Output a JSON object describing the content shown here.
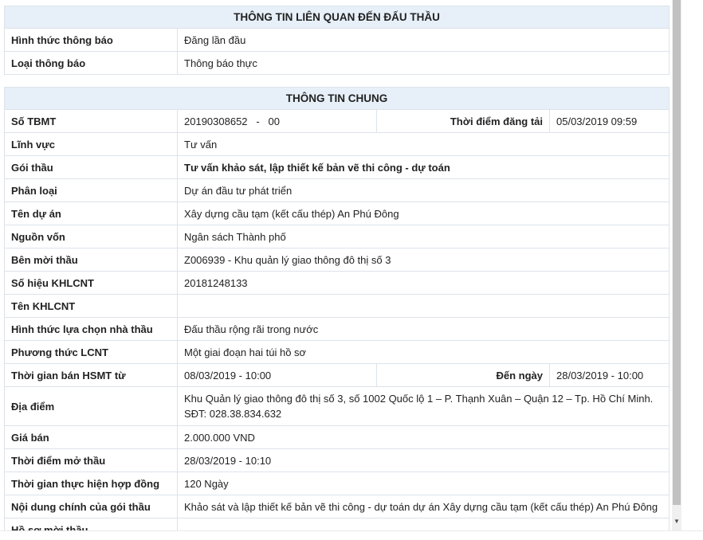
{
  "section1": {
    "title": "THÔNG TIN LIÊN QUAN ĐẾN ĐẤU THẦU",
    "rows": [
      {
        "label": "Hình thức thông báo",
        "value": "Đăng lần đầu"
      },
      {
        "label": "Loại thông báo",
        "value": "Thông báo thực"
      }
    ]
  },
  "section2": {
    "title": "THÔNG TIN CHUNG",
    "so_tbmt": {
      "label": "Số TBMT",
      "value": "20190308652   -   00",
      "sublabel": "Thời điểm đăng tải",
      "subvalue": "05/03/2019 09:59"
    },
    "linh_vuc": {
      "label": "Lĩnh vực",
      "value": "Tư vấn"
    },
    "goi_thau": {
      "label": "Gói thầu",
      "value": "Tư vấn khảo sát, lập thiết kế bản vẽ thi công - dự toán"
    },
    "phan_loai": {
      "label": "Phân loại",
      "value": "Dự án đầu tư phát triển"
    },
    "ten_du_an": {
      "label": "Tên dự án",
      "value": "Xây dựng cầu tạm (kết cấu thép) An Phú Đông"
    },
    "nguon_von": {
      "label": "Nguồn vốn",
      "value": "Ngân sách Thành phố"
    },
    "ben_moi_thau": {
      "label": "Bên mời thầu",
      "value": "Z006939 - Khu quản lý giao thông đô thị số 3"
    },
    "so_hieu_khlcnt": {
      "label": "Số hiệu KHLCNT",
      "value": "20181248133"
    },
    "ten_khlcnt": {
      "label": "Tên KHLCNT",
      "value": ""
    },
    "hinh_thuc_lcnt": {
      "label": "Hình thức lựa chọn nhà thầu",
      "value": "Đấu thầu rộng rãi trong nước"
    },
    "phuong_thuc": {
      "label": "Phương thức LCNT",
      "value": "Một giai đoạn hai túi hồ sơ"
    },
    "thoi_gian_ban": {
      "label": "Thời gian bán HSMT từ",
      "value": "08/03/2019 - 10:00",
      "sublabel": "Đến ngày",
      "subvalue": "28/03/2019 - 10:00"
    },
    "dia_diem": {
      "label": "Địa điểm",
      "value": "Khu Quản lý giao thông đô thị số 3, số 1002 Quốc lộ 1 – P. Thạnh Xuân – Quận 12 – Tp. Hồ Chí Minh. SĐT: 028.38.834.632"
    },
    "gia_ban": {
      "label": "Giá bán",
      "value": "2.000.000 VND"
    },
    "thoi_diem_mo_thau": {
      "label": "Thời điểm mở thầu",
      "value": "28/03/2019 - 10:10"
    },
    "thoi_gian_thuc_hien": {
      "label": "Thời gian thực hiện hợp đồng",
      "value": "120 Ngày"
    },
    "noi_dung": {
      "label": "Nội dung chính của gói thầu",
      "value": "Khảo sát và lập thiết kế bản vẽ thi công - dự toán dự án Xây dựng cầu tạm (kết cấu thép) An Phú Đông"
    },
    "ho_so": {
      "label": "Hồ sơ mời thầu",
      "value": ""
    }
  },
  "scrollbar": {
    "arrow_icon": "▼"
  }
}
